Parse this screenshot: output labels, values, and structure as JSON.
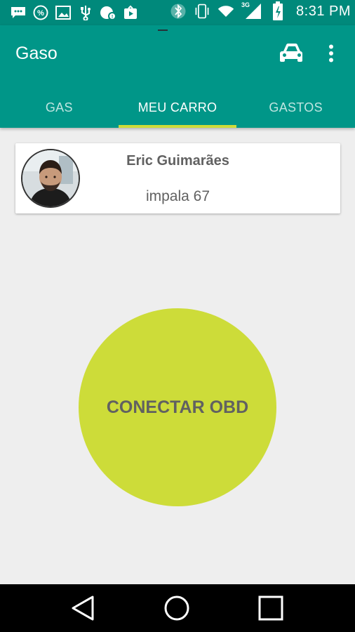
{
  "status_bar": {
    "time": "8:31 PM",
    "network_label": "3G",
    "icons": [
      "chat-icon",
      "percent-icon",
      "image-icon",
      "usb-icon",
      "notification-icon",
      "video-icon",
      "bluetooth-icon",
      "vibrate-icon",
      "wifi-icon",
      "signal-icon",
      "battery-charging-icon"
    ]
  },
  "app_bar": {
    "title": "Gaso",
    "action_icon": "car-icon",
    "overflow_icon": "more-vert-icon"
  },
  "tabs": [
    {
      "label": "GAS",
      "active": false
    },
    {
      "label": "MEU CARRO",
      "active": true
    },
    {
      "label": "GASTOS",
      "active": false
    }
  ],
  "profile": {
    "name": "Eric Guimarães",
    "car": "impala 67"
  },
  "main": {
    "connect_button_label": "CONECTAR OBD"
  },
  "colors": {
    "status_bar": "#00897b",
    "primary": "#009688",
    "accent": "#cddc39",
    "background": "#eeeeee",
    "text": "#616161"
  },
  "nav_bar": {
    "icons": [
      "back-icon",
      "home-icon",
      "recents-icon"
    ]
  }
}
